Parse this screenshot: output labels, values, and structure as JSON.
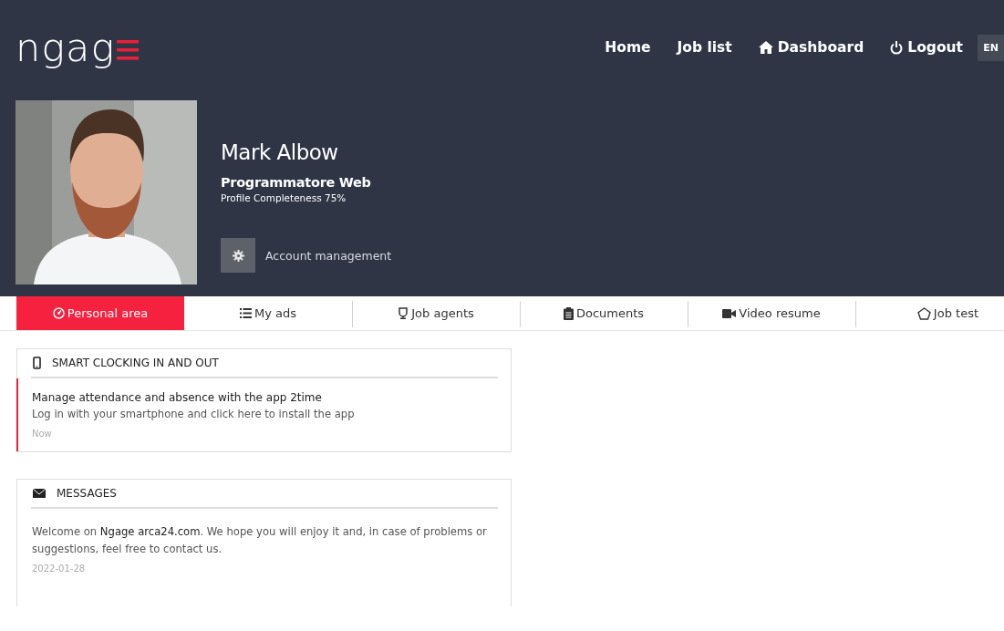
{
  "header": {
    "logo": "ngag",
    "nav": [
      {
        "label": "Home",
        "kind": "plain"
      },
      {
        "label": "Job list",
        "kind": "plain"
      },
      {
        "label": "Dashboard",
        "kind": "home"
      },
      {
        "label": "Logout",
        "kind": "power"
      }
    ],
    "language": "EN"
  },
  "profile": {
    "name": "Mark Albow",
    "job_title": "Programmatore Web",
    "completeness": "Profile Completeness 75%",
    "account_button": "Account management"
  },
  "tabs": [
    {
      "label": "Personal area",
      "selected": true
    },
    {
      "label": "My ads",
      "selected": false
    },
    {
      "label": "Job agents",
      "selected": false
    },
    {
      "label": "Documents",
      "selected": false
    },
    {
      "label": "Video resume",
      "selected": false
    },
    {
      "label": "Job test",
      "selected": false
    }
  ],
  "cards": [
    {
      "title": "SMART CLOCKING IN AND OUT",
      "kind": "phone",
      "items": [
        {
          "heading": "Manage attendance and absence with the app 2time",
          "text": "Log in with your smartphone and click here to install the app",
          "time": "Now",
          "highlighted": true
        }
      ]
    },
    {
      "title": "MESSAGES",
      "kind": "mail",
      "items": [
        {
          "text": "Welcome on **Ngage arca24.com**. We hope you will enjoy it and, in case of problems or suggestions, feel free to contact us.",
          "time": "2022-01-28",
          "highlighted": false
        }
      ]
    }
  ]
}
